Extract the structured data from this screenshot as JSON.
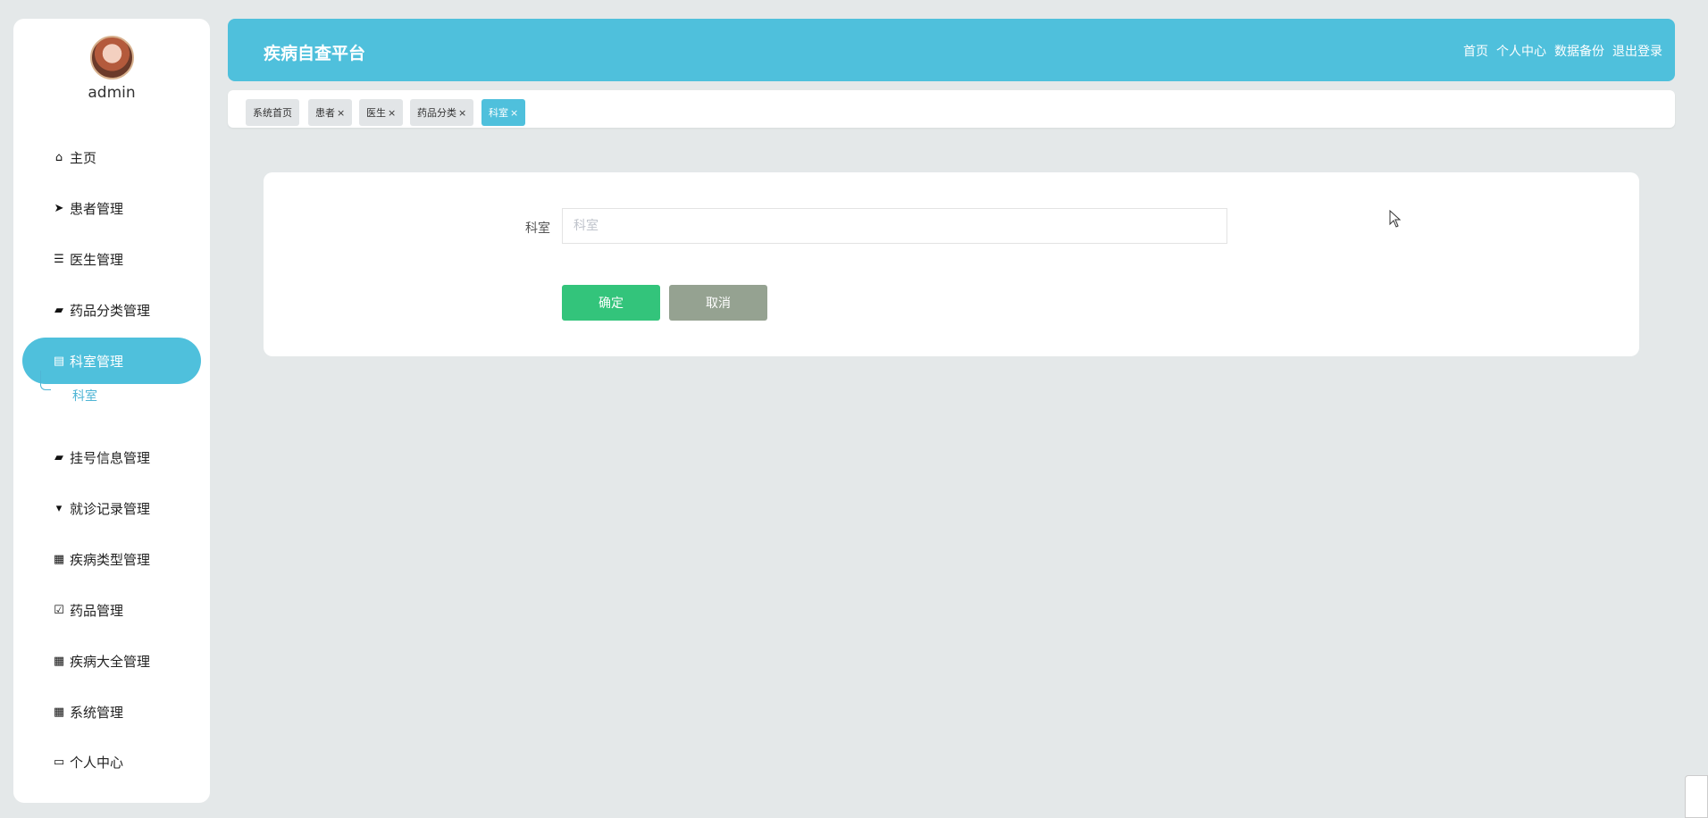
{
  "user": {
    "name": "admin"
  },
  "sidebar": {
    "items": [
      {
        "label": "主页",
        "icon": "home-icon"
      },
      {
        "label": "患者管理",
        "icon": "send-icon"
      },
      {
        "label": "医生管理",
        "icon": "list-icon"
      },
      {
        "label": "药品分类管理",
        "icon": "briefcase-icon"
      },
      {
        "label": "科室管理",
        "icon": "clipboard-icon"
      },
      {
        "label": "挂号信息管理",
        "icon": "wallet-icon"
      },
      {
        "label": "就诊记录管理",
        "icon": "paint-icon"
      },
      {
        "label": "疾病类型管理",
        "icon": "grid-icon"
      },
      {
        "label": "药品管理",
        "icon": "clipboard-check-icon"
      },
      {
        "label": "疾病大全管理",
        "icon": "grid-icon"
      },
      {
        "label": "系统管理",
        "icon": "grid-icon"
      },
      {
        "label": "个人中心",
        "icon": "card-icon"
      }
    ],
    "active_index": 4,
    "submenu": {
      "label": "科室"
    }
  },
  "header": {
    "title": "疾病自查平台",
    "links": [
      "首页",
      "个人中心",
      "数据备份",
      "退出登录"
    ]
  },
  "tabs": [
    {
      "label": "系统首页",
      "closable": false
    },
    {
      "label": "患者",
      "closable": true
    },
    {
      "label": "医生",
      "closable": true
    },
    {
      "label": "药品分类",
      "closable": true
    },
    {
      "label": "科室",
      "closable": true,
      "active": true
    }
  ],
  "form": {
    "label": "科室",
    "placeholder": "科室",
    "value": "",
    "ok_label": "确定",
    "cancel_label": "取消"
  },
  "colors": {
    "accent": "#4fc0dc",
    "ok": "#33c47b",
    "cancel": "#95a291",
    "background": "#e4e8e9"
  }
}
